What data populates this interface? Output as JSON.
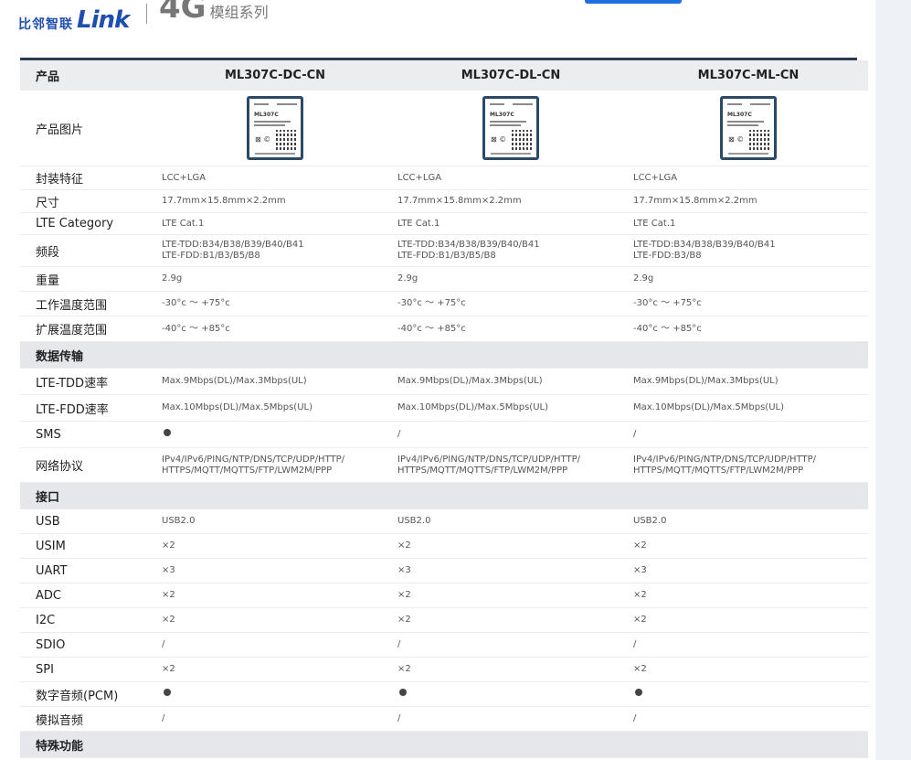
{
  "header": {
    "logo_cn": "比邻智联",
    "logo_en": "Link",
    "series_big": "4G",
    "series_small": "模组系列"
  },
  "table": {
    "head_label": "产品",
    "products": [
      "ML307C-DC-CN",
      "ML307C-DL-CN",
      "ML307C-ML-CN"
    ],
    "image_label": "产品图片",
    "chip_model": "ML307C",
    "basic_rows": [
      {
        "label": "封装特征",
        "values": [
          "LCC+LGA",
          "LCC+LGA",
          "LCC+LGA"
        ]
      },
      {
        "label": "尺寸",
        "values": [
          "17.7mm×15.8mm×2.2mm",
          "17.7mm×15.8mm×2.2mm",
          "17.7mm×15.8mm×2.2mm"
        ]
      },
      {
        "label": "LTE Category",
        "values": [
          "LTE Cat.1",
          "LTE Cat.1",
          "LTE Cat.1"
        ]
      },
      {
        "label": "频段",
        "values": [
          [
            "LTE-TDD:B34/B38/B39/B40/B41",
            "LTE-FDD:B1/B3/B5/B8"
          ],
          [
            "LTE-TDD:B34/B38/B39/B40/B41",
            "LTE-FDD:B1/B3/B5/B8"
          ],
          [
            "LTE-TDD:B34/B38/B39/B40/B41",
            "LTE-FDD:B3/B8"
          ]
        ]
      },
      {
        "label": "重量",
        "values": [
          "2.9g",
          "2.9g",
          "2.9g"
        ]
      },
      {
        "label": "工作温度范围",
        "values": [
          "-30°c ～ +75°c",
          "-30°c ～ +75°c",
          "-30°c ～ +75°c"
        ]
      },
      {
        "label": "扩展温度范围",
        "values": [
          "-40°c ～ +85°c",
          "-40°c ～ +85°c",
          "-40°c ～ +85°c"
        ]
      }
    ],
    "section_data": "数据传输",
    "data_rows": [
      {
        "label": "LTE-TDD速率",
        "values": [
          "Max.9Mbps(DL)/Max.3Mbps(UL)",
          "Max.9Mbps(DL)/Max.3Mbps(UL)",
          "Max.9Mbps(DL)/Max.3Mbps(UL)"
        ]
      },
      {
        "label": "LTE-FDD速率",
        "values": [
          "Max.10Mbps(DL)/Max.5Mbps(UL)",
          "Max.10Mbps(DL)/Max.5Mbps(UL)",
          "Max.10Mbps(DL)/Max.5Mbps(UL)"
        ]
      },
      {
        "label": "SMS",
        "values": [
          "●",
          "/",
          "/"
        ]
      },
      {
        "label": "网络协议",
        "values": [
          [
            "IPv4/IPv6/PING/NTP/DNS/TCP/UDP/HTTP/",
            "HTTPS/MQTT/MQTTS/FTP/LWM2M/PPP"
          ],
          [
            "IPv4/IPv6/PING/NTP/DNS/TCP/UDP/HTTP/",
            "HTTPS/MQTT/MQTTS/FTP/LWM2M/PPP"
          ],
          [
            "IPv4/IPv6/PING/NTP/DNS/TCP/UDP/HTTP/",
            "HTTPS/MQTT/MQTTS/FTP/LWM2M/PPP"
          ]
        ]
      }
    ],
    "section_interface": "接口",
    "interface_rows": [
      {
        "label": "USB",
        "values": [
          "USB2.0",
          "USB2.0",
          "USB2.0"
        ]
      },
      {
        "label": "USIM",
        "values": [
          "×2",
          "×2",
          "×2"
        ]
      },
      {
        "label": "UART",
        "values": [
          "×3",
          "×3",
          "×3"
        ]
      },
      {
        "label": "ADC",
        "values": [
          "×2",
          "×2",
          "×2"
        ]
      },
      {
        "label": "I2C",
        "values": [
          "×2",
          "×2",
          "×2"
        ]
      },
      {
        "label": "SDIO",
        "values": [
          "/",
          "/",
          "/"
        ]
      },
      {
        "label": "SPI",
        "values": [
          "×2",
          "×2",
          "×2"
        ]
      },
      {
        "label": "数字音频(PCM)",
        "values": [
          "●",
          "●",
          "●"
        ]
      },
      {
        "label": "模拟音频",
        "values": [
          "/",
          "/",
          "/"
        ]
      }
    ],
    "section_special": "特殊功能"
  }
}
